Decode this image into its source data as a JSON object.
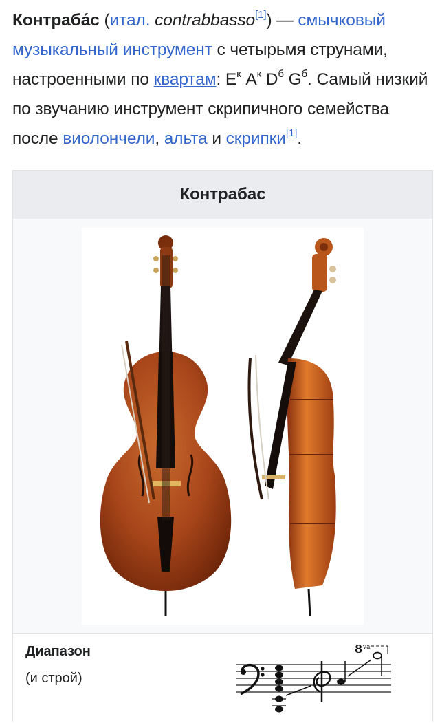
{
  "intro": {
    "term": "Контраба́с",
    "open_paren": " (",
    "lang_link": "итал.",
    "space": " ",
    "foreign_word": "contrabbasso",
    "ref1": "[1]",
    "close_dash": ") — ",
    "link_bowed": "смычковый",
    "space2": " ",
    "link_instrument": "музыкальный инструмент",
    "text_strings": " с четырьмя струнами, настроенными по ",
    "link_quarts": "квартам",
    "text_tuning": ": E",
    "sup_k1": "к",
    "text_a": " A",
    "sup_k2": "к",
    "text_d": " D",
    "sup_b1": "б",
    "text_g": " G",
    "sup_b2": "б",
    "text_rest": ". Самый низкий по звучанию инструмент скрипичного семейства после ",
    "link_cello": "виолончели",
    "comma": ", ",
    "link_viola": "альта",
    "and": " и ",
    "link_violin": "скрипки",
    "ref2": "[1]",
    "end": "."
  },
  "infobox": {
    "title": "Контрабас",
    "range_label": "Диапазон",
    "range_sub": "(и строй)",
    "octave_mark": "8",
    "octave_suffix": "va"
  },
  "colors": {
    "link": "#3366cc",
    "text": "#202122",
    "infobox_bg": "#f8f9fa",
    "title_bg": "#eaecf0",
    "wood": "#a8461a"
  }
}
